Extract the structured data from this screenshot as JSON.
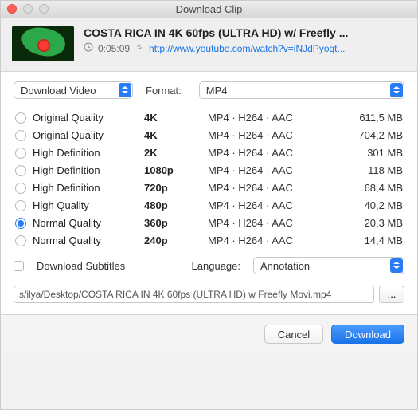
{
  "window": {
    "title": "Download Clip"
  },
  "header": {
    "title": "COSTA RICA IN 4K 60fps (ULTRA HD) w/ Freefly ...",
    "duration": "0:05:09",
    "url_text": "http://www.youtube.com/watch?v=iNJdPyoqt..."
  },
  "mode": {
    "selected": "Download Video",
    "format_label": "Format:",
    "format_selected": "MP4"
  },
  "options": [
    {
      "quality": "Original Quality",
      "res": "4K",
      "codec": "MP4 · H264 · AAC",
      "size": "611,5 MB",
      "selected": false
    },
    {
      "quality": "Original Quality",
      "res": "4K",
      "codec": "MP4 · H264 · AAC",
      "size": "704,2 MB",
      "selected": false
    },
    {
      "quality": "High Definition",
      "res": "2K",
      "codec": "MP4 · H264 · AAC",
      "size": "301 MB",
      "selected": false
    },
    {
      "quality": "High Definition",
      "res": "1080p",
      "codec": "MP4 · H264 · AAC",
      "size": "118 MB",
      "selected": false
    },
    {
      "quality": "High Definition",
      "res": "720p",
      "codec": "MP4 · H264 · AAC",
      "size": "68,4 MB",
      "selected": false
    },
    {
      "quality": "High Quality",
      "res": "480p",
      "codec": "MP4 · H264 · AAC",
      "size": "40,2 MB",
      "selected": false
    },
    {
      "quality": "Normal Quality",
      "res": "360p",
      "codec": "MP4 · H264 · AAC",
      "size": "20,3 MB",
      "selected": true
    },
    {
      "quality": "Normal Quality",
      "res": "240p",
      "codec": "MP4 · H264 · AAC",
      "size": "14,4 MB",
      "selected": false
    }
  ],
  "subtitles": {
    "checkbox_label": "Download Subtitles",
    "checked": false,
    "language_label": "Language:",
    "language_selected": "Annotation"
  },
  "path": {
    "value": "s/ilya/Desktop/COSTA RICA IN 4K 60fps (ULTRA HD) w  Freefly Movi.mp4",
    "browse_label": "..."
  },
  "buttons": {
    "cancel": "Cancel",
    "download": "Download"
  }
}
